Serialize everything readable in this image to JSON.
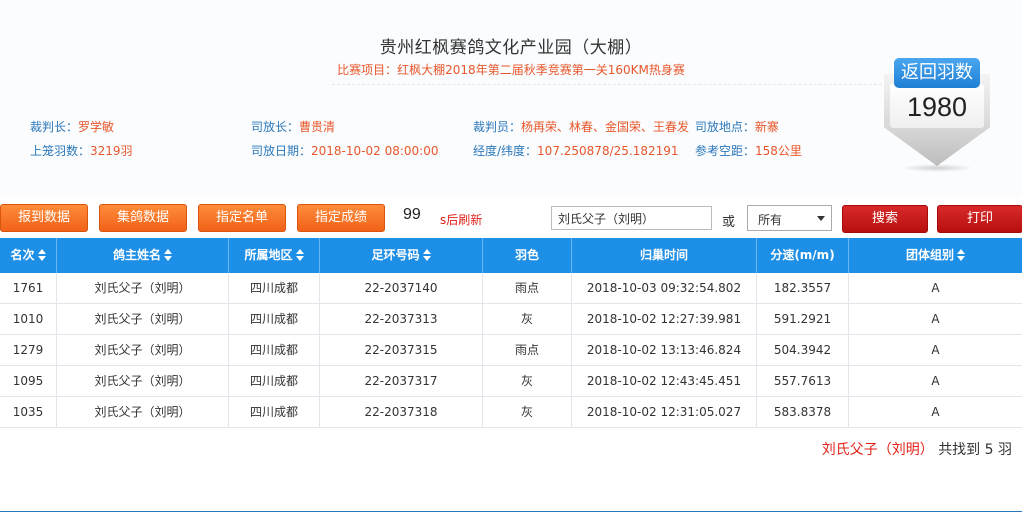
{
  "header": {
    "title": "贵州红枫赛鸽文化产业园（大棚）",
    "subtitle": "比赛项目：红枫大棚2018年第二届秋季竞赛第一关160KM热身赛"
  },
  "info": {
    "referee_chief": {
      "label": "裁判长：",
      "value": "罗学敏"
    },
    "cage_count": {
      "label": "上笼羽数：",
      "value": "3219羽"
    },
    "release_chief": {
      "label": "司放长：",
      "value": "曹贵清"
    },
    "release_date": {
      "label": "司放日期：",
      "value": "2018-10-02 08:00:00"
    },
    "referees": {
      "label": "裁判员：",
      "value": "杨再荣、林春、金国荣、王春发"
    },
    "release_place": {
      "label": "司放地点：",
      "value": "新寨"
    },
    "coordinates": {
      "label": "经度/纬度：",
      "value": "107.250878/25.182191"
    },
    "distance": {
      "label": "参考空距：",
      "value": "158公里"
    }
  },
  "badge": {
    "label": "返回羽数",
    "value": "1980"
  },
  "toolbar": {
    "buttons": [
      "报到数据",
      "集鸽数据",
      "指定名单",
      "指定成绩"
    ],
    "countdown": "99",
    "refresh_label": "s后刷新",
    "search_value": "刘氏父子（刘明）",
    "or_label": "或",
    "select_value": "所有",
    "search_button": "搜索",
    "print_button": "打印"
  },
  "table": {
    "columns": [
      "名次",
      "鸽主姓名",
      "所属地区",
      "足环号码",
      "羽色",
      "归巢时间",
      "分速(m/m)",
      "团体组别"
    ],
    "rows": [
      [
        "1761",
        "刘氏父子（刘明）",
        "四川成都",
        "22-2037140",
        "雨点",
        "2018-10-03 09:32:54.802",
        "182.3557",
        "A"
      ],
      [
        "1010",
        "刘氏父子（刘明）",
        "四川成都",
        "22-2037313",
        "灰",
        "2018-10-02 12:27:39.981",
        "591.2921",
        "A"
      ],
      [
        "1279",
        "刘氏父子（刘明）",
        "四川成都",
        "22-2037315",
        "雨点",
        "2018-10-02 13:13:46.824",
        "504.3942",
        "A"
      ],
      [
        "1095",
        "刘氏父子（刘明）",
        "四川成都",
        "22-2037317",
        "灰",
        "2018-10-02 12:43:45.451",
        "557.7613",
        "A"
      ],
      [
        "1035",
        "刘氏父子（刘明）",
        "四川成都",
        "22-2037318",
        "灰",
        "2018-10-02 12:31:05.027",
        "583.8378",
        "A"
      ]
    ]
  },
  "summary": {
    "name": "刘氏父子（刘明）",
    "text": "共找到 5 羽"
  },
  "colors": {
    "accent_blue": "#1e8fe6",
    "orange": "#f06218",
    "red": "#b80f0f"
  }
}
